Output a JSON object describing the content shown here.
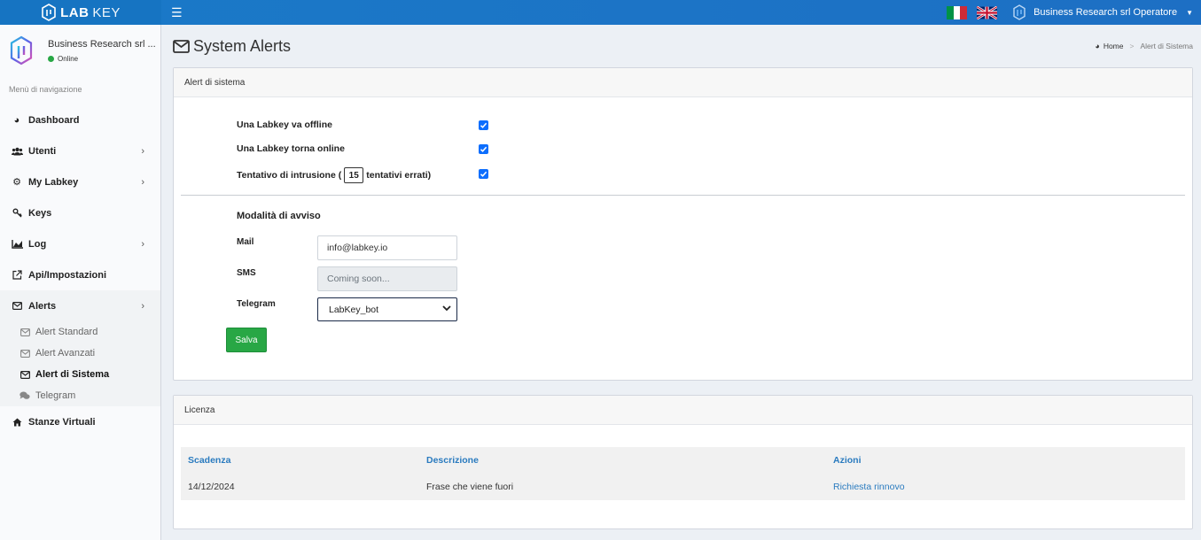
{
  "brand": {
    "lab": "LAB",
    "key": "KEY"
  },
  "topbar": {
    "user_label": "Business Research srl Operatore"
  },
  "sidebar": {
    "user_name": "Business Research srl ...",
    "status": "Online",
    "nav_header": "Menù di navigazione",
    "items": [
      {
        "label": "Dashboard",
        "icon": "dashboard-icon"
      },
      {
        "label": "Utenti",
        "icon": "users-icon"
      },
      {
        "label": "My Labkey",
        "icon": "gear-icon"
      },
      {
        "label": "Keys",
        "icon": "key-icon"
      },
      {
        "label": "Log",
        "icon": "chart-icon"
      },
      {
        "label": "Api/Impostazioni",
        "icon": "external-link-icon"
      },
      {
        "label": "Alerts",
        "icon": "envelope-icon"
      },
      {
        "label": "Stanze Virtuali",
        "icon": "home-icon"
      }
    ],
    "alerts_sub": [
      {
        "label": "Alert Standard",
        "icon": "envelope-icon"
      },
      {
        "label": "Alert Avanzati",
        "icon": "envelope-icon"
      },
      {
        "label": "Alert di Sistema",
        "icon": "envelope-icon"
      },
      {
        "label": "Telegram",
        "icon": "comments-icon"
      }
    ]
  },
  "page": {
    "title": "System Alerts",
    "breadcrumb_home": "Home",
    "breadcrumb_current": "Alert di Sistema"
  },
  "system_alerts": {
    "header": "Alert di sistema",
    "offline_label": "Una Labkey va offline",
    "online_label": "Una Labkey torna online",
    "intrusion_prefix": "Tentativo di intrusione (",
    "intrusion_value": "15",
    "intrusion_suffix": "tentativi errati)",
    "checked": [
      true,
      true,
      true
    ],
    "notify_title": "Modalità di avviso",
    "mail_label": "Mail",
    "mail_value": "info@labkey.io",
    "sms_label": "SMS",
    "sms_placeholder": "Coming soon...",
    "telegram_label": "Telegram",
    "telegram_value": "LabKey_bot",
    "save_label": "Salva"
  },
  "license": {
    "header": "Licenza",
    "columns": [
      "Scadenza",
      "Descrizione",
      "Azioni"
    ],
    "rows": [
      {
        "expiry": "14/12/2024",
        "description": "Frase che viene fuori",
        "action": "Richiesta rinnovo"
      }
    ]
  },
  "colors": {
    "topbar": "#1d6fc4",
    "accent_link": "#2a7bbf",
    "save_button": "#28a745",
    "checkbox": "#0d6efd",
    "status_online": "#28a745"
  }
}
